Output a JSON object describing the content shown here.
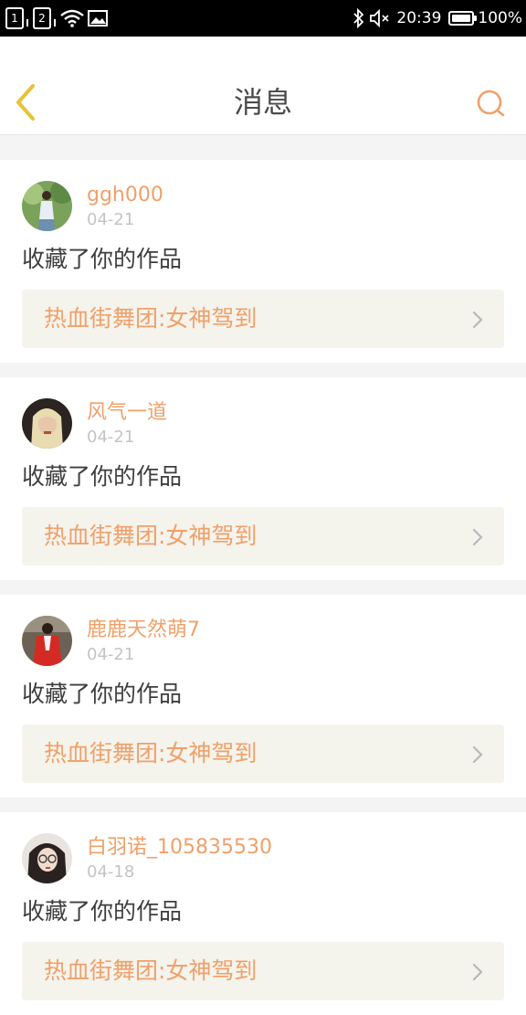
{
  "status_bar": {
    "sim1": "1",
    "sim2": "2",
    "time": "20:39",
    "battery": "100%",
    "battery_level": 1.0,
    "icons": [
      "sim-card-icon",
      "wifi-icon",
      "image-icon",
      "bluetooth-icon",
      "mute-icon",
      "battery-icon"
    ]
  },
  "header": {
    "title": "消息",
    "back_icon": "chevron-left-icon",
    "search_icon": "search-icon"
  },
  "colors": {
    "accent": "#f0a06a",
    "back_arrow": "#e8c23a",
    "text": "#3e3e3e",
    "muted": "#c4c4c4",
    "card_link_bg": "#f4f3ec"
  },
  "messages": [
    {
      "username": "ggh000",
      "date": "04-21",
      "action": "收藏了你的作品",
      "work_title": "热血街舞团:女神驾到"
    },
    {
      "username": "风气一道",
      "date": "04-21",
      "action": "收藏了你的作品",
      "work_title": "热血街舞团:女神驾到"
    },
    {
      "username": "鹿鹿天然萌7",
      "date": "04-21",
      "action": "收藏了你的作品",
      "work_title": "热血街舞团:女神驾到"
    },
    {
      "username": "白羽诺_105835530",
      "date": "04-18",
      "action": "收藏了你的作品",
      "work_title": "热血街舞团:女神驾到"
    }
  ]
}
